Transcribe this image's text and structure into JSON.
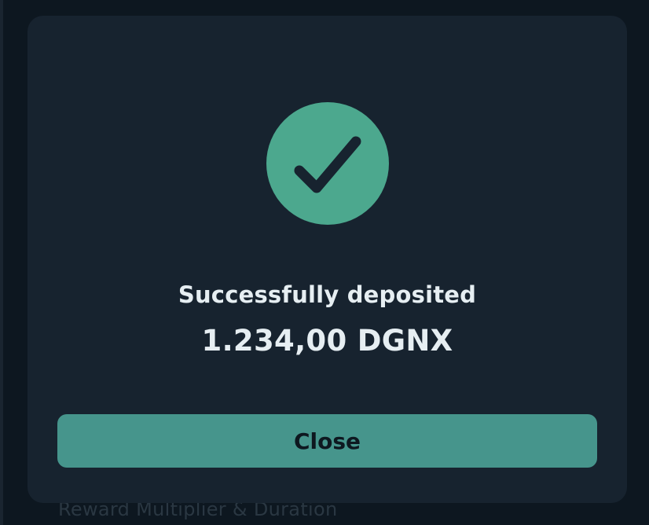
{
  "background": {
    "label": "Reward Multiplier & Duration"
  },
  "modal": {
    "icon": "checkmark-icon",
    "title": "Successfully deposited",
    "amount": "1.234,00 DGNX",
    "close_label": "Close"
  },
  "colors": {
    "accent_circle": "#4ca88e",
    "button": "#46958c",
    "modal_bg": "#17232f",
    "text": "#e6eef2"
  }
}
